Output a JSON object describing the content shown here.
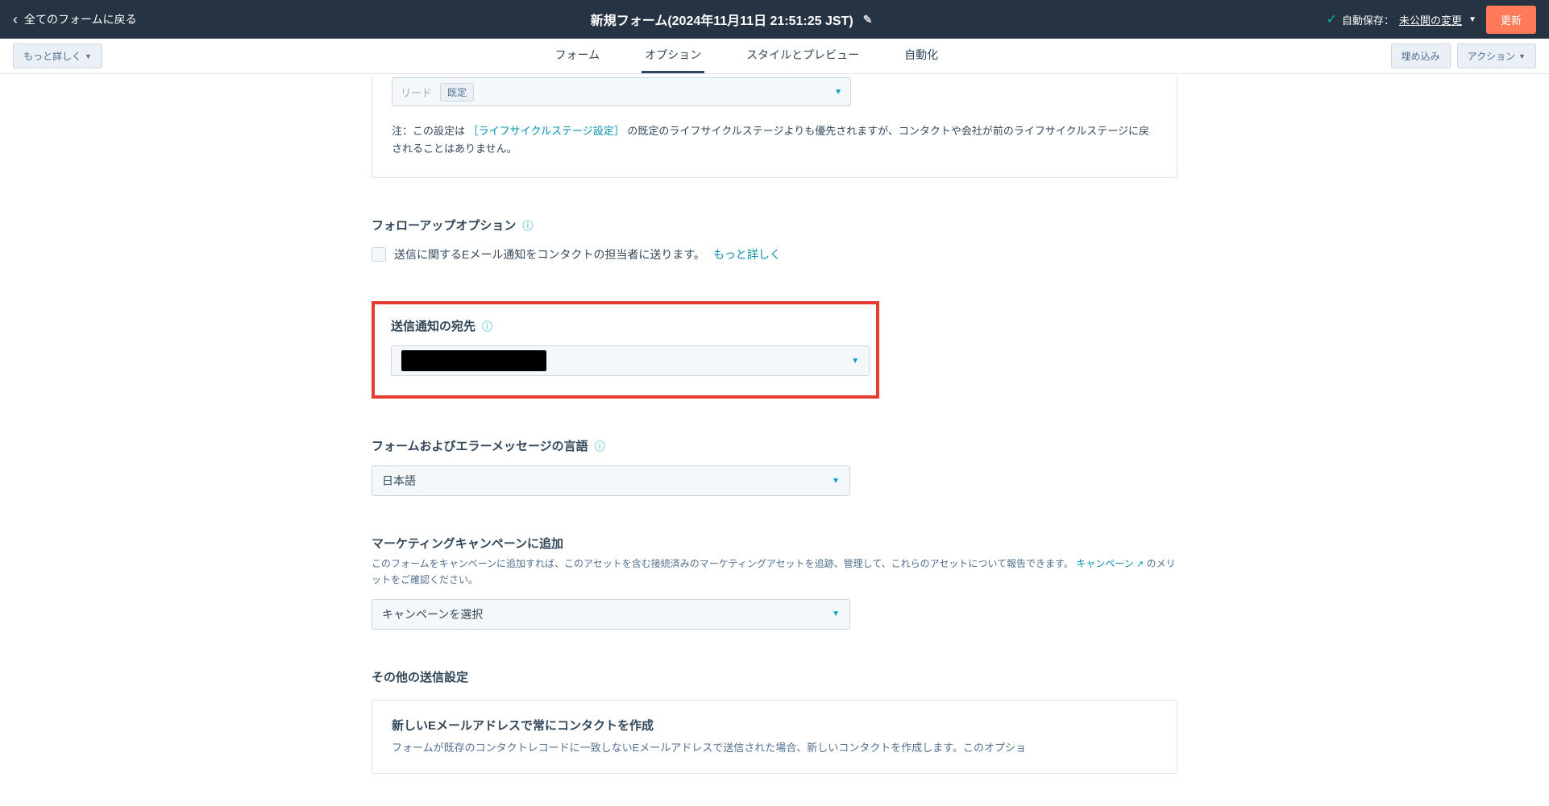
{
  "header": {
    "back_label": "全てのフォームに戻る",
    "title": "新規フォーム(2024年11月11日 21:51:25 JST)",
    "autosave_prefix": "自動保存：",
    "autosave_status": "未公開の変更",
    "update_btn": "更新"
  },
  "subnav": {
    "more_btn": "もっと詳しく",
    "tabs": {
      "form": "フォーム",
      "options": "オプション",
      "style": "スタイルとプレビュー",
      "automation": "自動化"
    },
    "embed_btn": "埋め込み",
    "action_btn": "アクション"
  },
  "lead": {
    "label": "リード",
    "badge": "既定"
  },
  "note": {
    "prefix": "注：この設定は",
    "link": "［ライフサイクルステージ設定］",
    "suffix": "の既定のライフサイクルステージよりも優先されますが、コンタクトや会社が前のライフサイクルステージに戻されることはありません。"
  },
  "followup": {
    "title": "フォローアップオプション",
    "checkbox_label": "送信に関するEメール通知をコンタクトの担当者に送ります。",
    "more": "もっと詳しく"
  },
  "notify": {
    "title": "送信通知の宛先"
  },
  "language": {
    "title": "フォームおよびエラーメッセージの言語",
    "value": "日本語"
  },
  "campaign": {
    "title": "マーケティングキャンペーンに追加",
    "desc_prefix": "このフォームをキャンペーンに追加すれば、このアセットを含む接続済みのマーケティングアセットを追跡、管理して、これらのアセットについて報告できます。",
    "link": "キャンペーン",
    "desc_suffix": "のメリットをご確認ください。",
    "placeholder": "キャンペーンを選択"
  },
  "other": {
    "title": "その他の送信設定",
    "card_title": "新しいEメールアドレスで常にコンタクトを作成",
    "card_desc": "フォームが既存のコンタクトレコードに一致しないEメールアドレスで送信された場合、新しいコンタクトを作成します。このオプショ"
  }
}
